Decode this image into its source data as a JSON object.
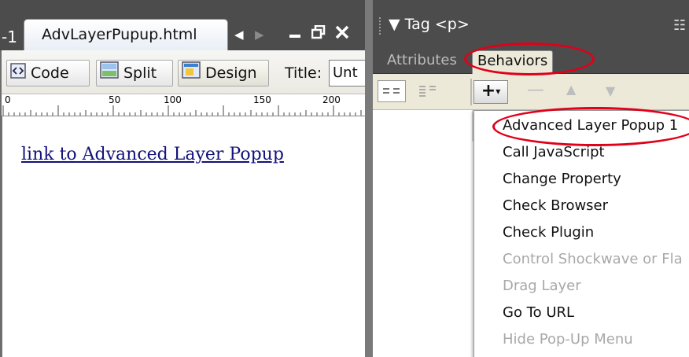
{
  "document_window": {
    "prev_tab_fragment": "-1",
    "active_tab_label": "AdvLayerPupup.html",
    "scroll_left": "◀",
    "scroll_right": "▶",
    "minimize": "▁",
    "restore": "🗗",
    "close": "✕",
    "toolbar": {
      "code_label": "Code",
      "split_label": "Split",
      "design_label": "Design",
      "title_label": "Title:",
      "title_value": "Unt"
    },
    "ruler_ticks": [
      "0",
      "50",
      "100",
      "150",
      "200"
    ],
    "link_text": "link to Advanced Layer Popup"
  },
  "panel": {
    "title": "▼ Tag <p>",
    "menu_icon": "☷",
    "tabs": {
      "attributes": "Attributes",
      "behaviors": "Behaviors"
    },
    "toolbar": {
      "plus": "+",
      "minus": "—",
      "up": "▲",
      "down": "▼"
    },
    "menu_items": [
      {
        "label": "Advanced Layer Popup 1",
        "enabled": true
      },
      {
        "label": "Call JavaScript",
        "enabled": true
      },
      {
        "label": "Change Property",
        "enabled": true
      },
      {
        "label": "Check Browser",
        "enabled": true
      },
      {
        "label": "Check Plugin",
        "enabled": true
      },
      {
        "label": "Control Shockwave or Fla",
        "enabled": false
      },
      {
        "label": "Drag Layer",
        "enabled": false
      },
      {
        "label": "Go To URL",
        "enabled": true
      },
      {
        "label": "Hide Pop-Up Menu",
        "enabled": false
      }
    ]
  },
  "colors": {
    "title_bar": "#4c4c4c",
    "highlight_oval": "#e0001a",
    "link": "#12127a",
    "disabled_text": "#a8a8a8"
  }
}
